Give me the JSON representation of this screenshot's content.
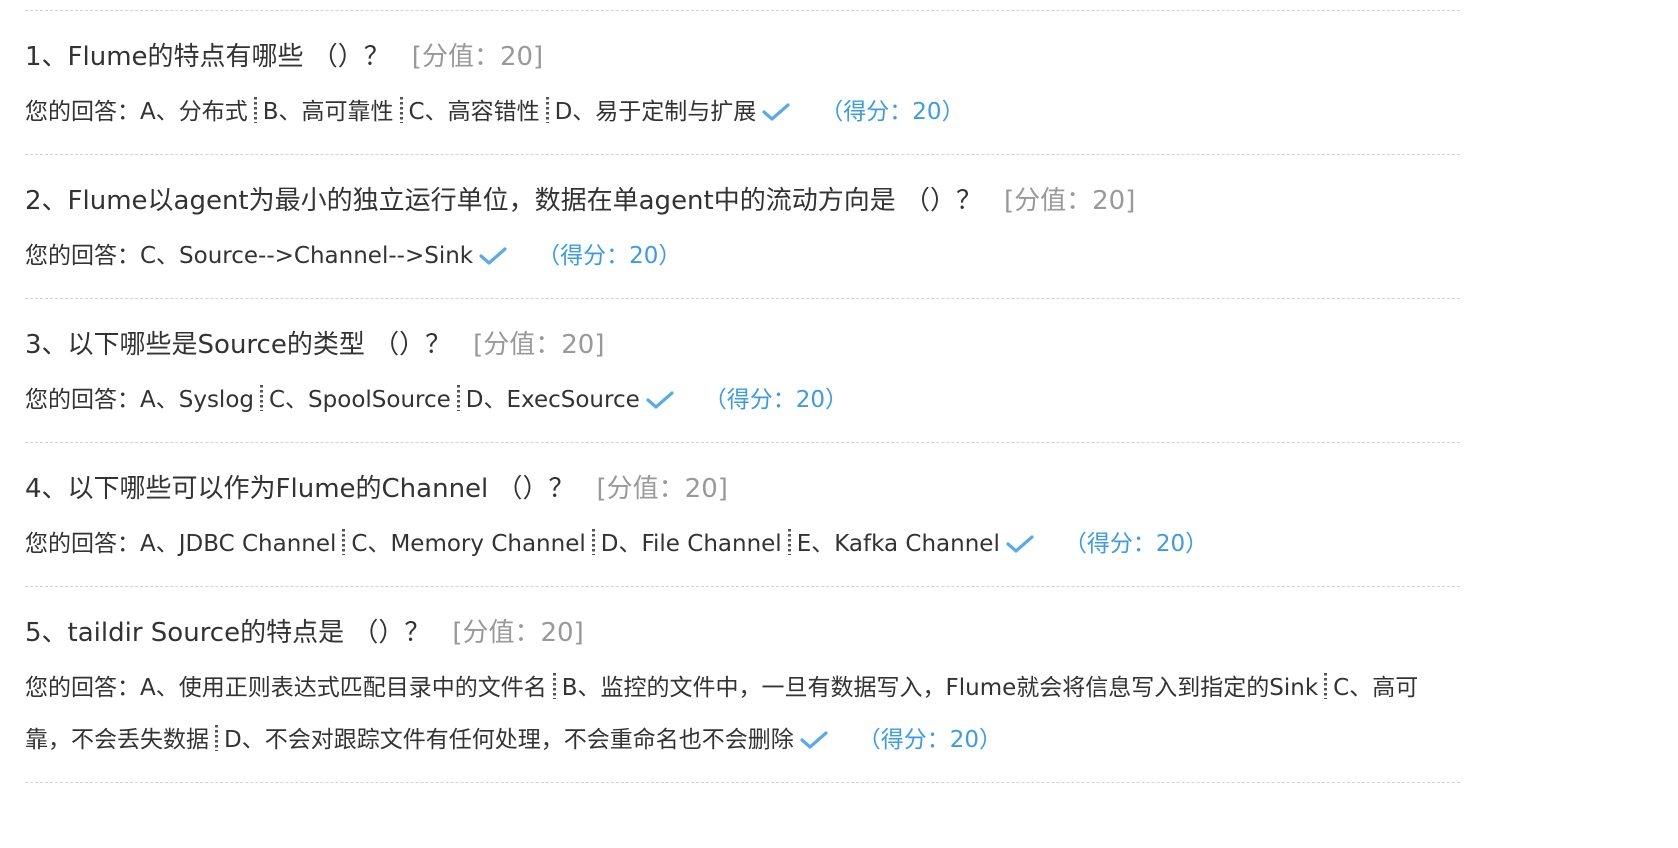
{
  "questions": [
    {
      "title": "1、Flume的特点有哪些 （）？",
      "value": "[分值：20]",
      "answer_prefix": "您的回答：",
      "options": [
        "A、分布式",
        "B、高可靠性",
        "C、高容错性",
        "D、易于定制与扩展"
      ],
      "score": "（得分：20）"
    },
    {
      "title": "2、Flume以agent为最小的独立运行单位，数据在单agent中的流动方向是 （）？",
      "value": "[分值：20]",
      "answer_prefix": "您的回答：",
      "options": [
        "C、Source-->Channel-->Sink"
      ],
      "score": "（得分：20）"
    },
    {
      "title": "3、以下哪些是Source的类型 （）？",
      "value": "[分值：20]",
      "answer_prefix": "您的回答：",
      "options": [
        "A、Syslog",
        "C、SpoolSource",
        "D、ExecSource"
      ],
      "score": "（得分：20）"
    },
    {
      "title": "4、以下哪些可以作为Flume的Channel （）？",
      "value": "[分值：20]",
      "answer_prefix": "您的回答：",
      "options": [
        "A、JDBC Channel",
        "C、Memory Channel",
        "D、File Channel",
        "E、Kafka Channel"
      ],
      "score": "（得分：20）"
    },
    {
      "title": "5、taildir Source的特点是 （）？",
      "value": "[分值：20]",
      "answer_prefix": "您的回答：",
      "options": [
        "A、使用正则表达式匹配目录中的文件名",
        "B、监控的文件中，一旦有数据写入，Flume就会将信息写入到指定的Sink",
        "C、高可靠，不会丢失数据",
        "D、不会对跟踪文件有任何处理，不会重命名也不会删除"
      ],
      "score": "（得分：20）"
    }
  ],
  "icons": {
    "check": "check-icon"
  },
  "colors": {
    "text": "#333333",
    "muted": "#999999",
    "score": "#3c9be8",
    "check": "#5aa9ec",
    "divider": "#d2d2d2"
  }
}
